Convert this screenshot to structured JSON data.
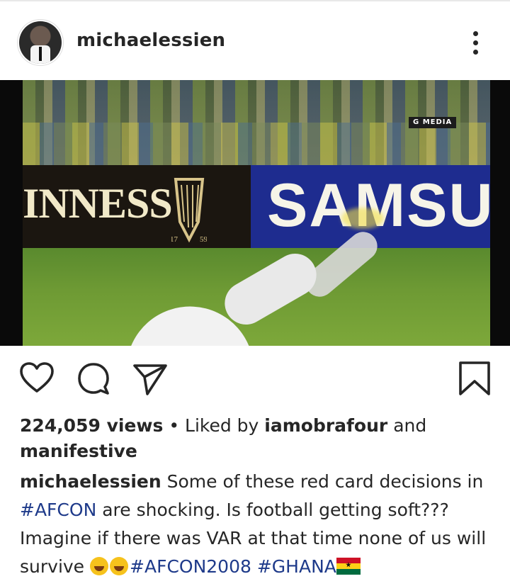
{
  "header": {
    "username": "michaelessien",
    "avatar_icon": "profile-photo",
    "menu_icon": "more-vertical-icon"
  },
  "media": {
    "watermark": "G MEDIA",
    "ad_left": "INNESS",
    "ad_right": "SAMSU",
    "harp_year_left": "17",
    "harp_year_right": "59"
  },
  "actions": {
    "like_icon": "heart-icon",
    "comment_icon": "comment-icon",
    "share_icon": "send-icon",
    "save_icon": "bookmark-icon"
  },
  "stats": {
    "views": "224,059 views",
    "separator": " • Liked by ",
    "liked_user1": "iamobrafour",
    "and": " and",
    "liked_user2": "manifestive"
  },
  "caption": {
    "author": "michaelessien",
    "text1": " Some of these red card decisions in ",
    "hashtag1": "#AFCON",
    "text2": " are shocking. Is football getting soft??? Imagine if there was VAR at that time none of us will survive ",
    "hashtag2": "#AFCON2008",
    "hashtag3": "#GHANA",
    "emoji_name": "tears-of-joy",
    "flag_name": "ghana-flag"
  },
  "colors": {
    "text": "#262626",
    "hashtag": "#1e3a8a",
    "background": "#ffffff"
  }
}
